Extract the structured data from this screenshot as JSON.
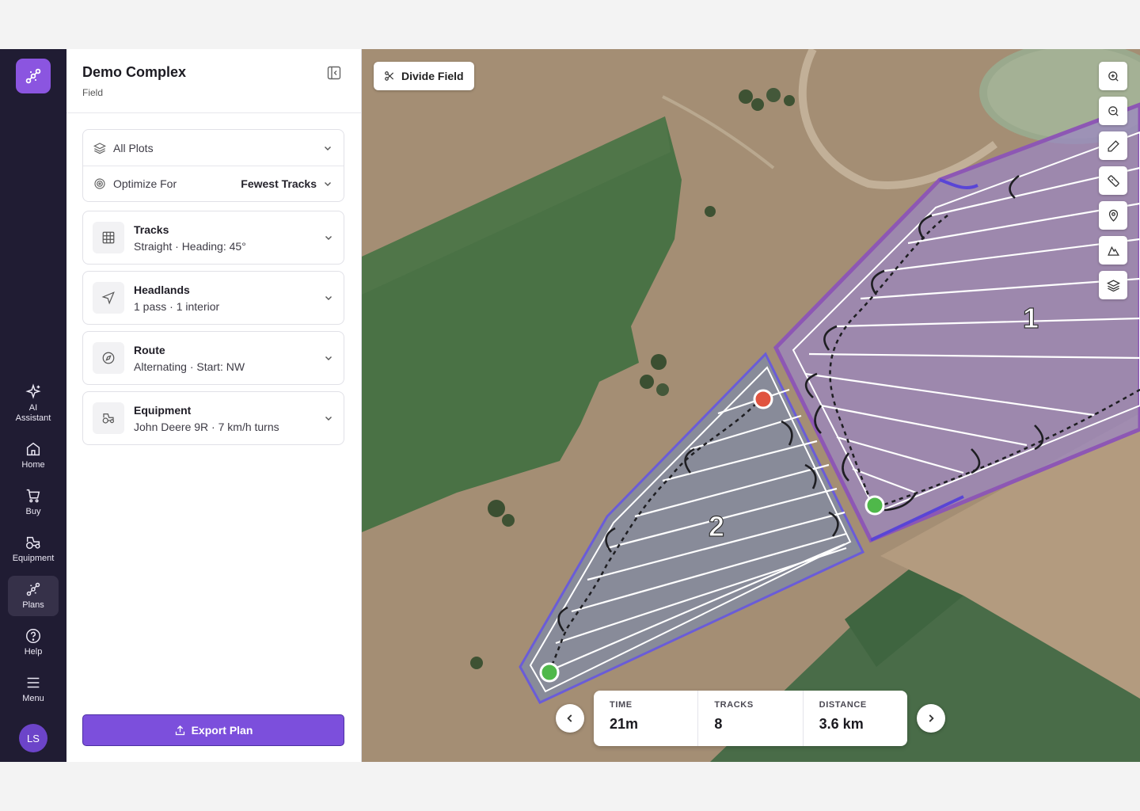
{
  "rail": {
    "items": [
      {
        "label": "AI Assistant",
        "icon": "sparkle-icon"
      },
      {
        "label": "Home",
        "icon": "home-icon"
      },
      {
        "label": "Buy",
        "icon": "cart-icon"
      },
      {
        "label": "Equipment",
        "icon": "tractor-icon"
      },
      {
        "label": "Plans",
        "icon": "route-icon",
        "active": true
      },
      {
        "label": "Help",
        "icon": "help-icon"
      },
      {
        "label": "Menu",
        "icon": "menu-icon"
      }
    ],
    "avatar_initials": "LS"
  },
  "panel": {
    "title": "Demo Complex",
    "subtitle": "Field",
    "plots_label": "All Plots",
    "optimize_label": "Optimize For",
    "optimize_value": "Fewest Tracks",
    "cards": [
      {
        "title": "Tracks",
        "detail": "Straight · Heading: 45°",
        "icon": "grid-icon"
      },
      {
        "title": "Headlands",
        "detail": "1 pass · 1 interior",
        "icon": "navigation-icon"
      },
      {
        "title": "Route",
        "detail": "Alternating · Start: NW",
        "icon": "compass-icon"
      },
      {
        "title": "Equipment",
        "detail": "John Deere 9R · 7 km/h turns",
        "icon": "tractor-icon"
      }
    ],
    "export_label": "Export Plan"
  },
  "map": {
    "divide_label": "Divide Field",
    "tools": [
      "zoom-in-icon",
      "zoom-out-icon",
      "pencil-icon",
      "ruler-icon",
      "pin-icon",
      "terrain-icon",
      "layers-icon"
    ],
    "plot_labels": [
      "1",
      "2"
    ],
    "stats": [
      {
        "key": "TIME",
        "value": "21m"
      },
      {
        "key": "TRACKS",
        "value": "8"
      },
      {
        "key": "DISTANCE",
        "value": "3.6 km"
      }
    ]
  },
  "colors": {
    "accent": "#7c4fdc",
    "rail_bg": "#201c33",
    "start_marker": "#4fb84a",
    "end_marker": "#e0533f",
    "plot1_fill": "#9a86c4",
    "plot2_fill": "#7d8aa8"
  }
}
